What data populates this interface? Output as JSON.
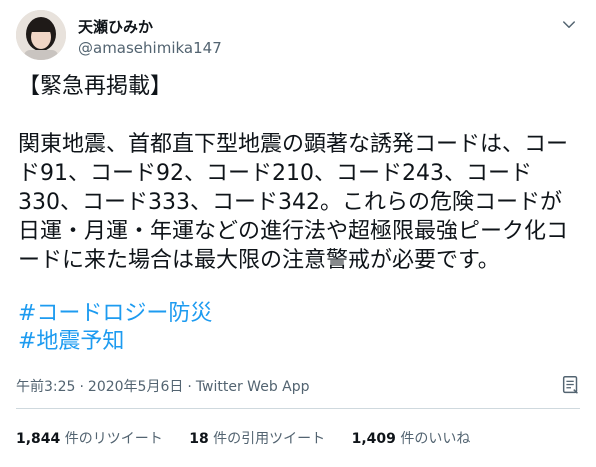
{
  "user": {
    "display_name": "天瀬ひみか",
    "handle": "@amasehimika147"
  },
  "tweet": {
    "title": "【緊急再掲載】",
    "body": "関東地震、首都直下型地震の顕著な誘発コードは、コード91、コード92、コード210、コード243、コード330、コード333、コード342。これらの危険コードが日運・月運・年運などの進行法や超極限最強ピーク化コードに来た場合は最大限の注意警戒が必要です。",
    "hashtags": [
      "#コードロジー防災",
      "#地震予知"
    ]
  },
  "meta": {
    "time": "午前3:25",
    "date": "2020年5月6日",
    "source": "Twitter Web App"
  },
  "stats": {
    "retweets_count": "1,844",
    "retweets_label": "件のリツイート",
    "quotes_count": "18",
    "quotes_label": "件の引用ツイート",
    "likes_count": "1,409",
    "likes_label": "件のいいね"
  },
  "icons": {
    "chevron": "chevron-down-icon",
    "info": "tweet-analytics-icon"
  },
  "colors": {
    "link": "#1d9bf0",
    "secondary_text": "#536471",
    "divider": "#cfd9de"
  }
}
